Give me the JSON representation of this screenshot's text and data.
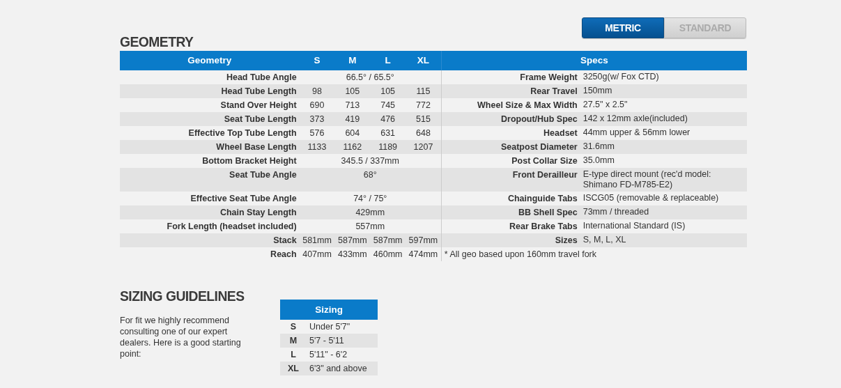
{
  "units_toggle": [
    {
      "label": "METRIC",
      "selected": true
    },
    {
      "label": "STANDARD",
      "selected": false
    }
  ],
  "geometry": {
    "title": "GEOMETRY",
    "columns": [
      "Geometry",
      "S",
      "M",
      "L",
      "XL"
    ],
    "rows": [
      {
        "label": "Head Tube Angle",
        "kind": "shared",
        "values": [
          "66.5° / 65.5°"
        ]
      },
      {
        "label": "Head Tube Length",
        "kind": "each",
        "values": [
          "98",
          "105",
          "105",
          "115"
        ]
      },
      {
        "label": "Stand Over Height",
        "kind": "each",
        "values": [
          "690",
          "713",
          "745",
          "772"
        ]
      },
      {
        "label": "Seat Tube Length",
        "kind": "each",
        "values": [
          "373",
          "419",
          "476",
          "515"
        ]
      },
      {
        "label": "Effective Top Tube Length",
        "kind": "each",
        "values": [
          "576",
          "604",
          "631",
          "648"
        ]
      },
      {
        "label": "Wheel Base Length",
        "kind": "each",
        "values": [
          "1133",
          "1162",
          "1189",
          "1207"
        ]
      },
      {
        "label": "Bottom Bracket Height",
        "kind": "shared",
        "values": [
          "345.5 / 337mm"
        ]
      },
      {
        "label": "Seat Tube Angle",
        "kind": "shared",
        "values": [
          "68°"
        ]
      },
      {
        "label": "Effective Seat Tube Angle",
        "kind": "shared",
        "values": [
          "74° / 75°"
        ]
      },
      {
        "label": "Chain Stay Length",
        "kind": "shared",
        "values": [
          "429mm"
        ]
      },
      {
        "label": "Fork Length (headset included)",
        "kind": "shared",
        "values": [
          "557mm"
        ]
      },
      {
        "label": "Stack",
        "kind": "each",
        "values": [
          "581mm",
          "587mm",
          "587mm",
          "597mm"
        ]
      },
      {
        "label": "Reach",
        "kind": "each",
        "values": [
          "407mm",
          "433mm",
          "460mm",
          "474mm"
        ]
      }
    ]
  },
  "specs": {
    "heading": "Specs",
    "rows": [
      {
        "label": "Frame Weight",
        "value": "3250g(w/ Fox CTD)"
      },
      {
        "label": "Rear Travel",
        "value": "150mm"
      },
      {
        "label": "Wheel Size & Max Width",
        "value": "27.5\" x 2.5\""
      },
      {
        "label": "Dropout/Hub Spec",
        "value": "142 x 12mm axle(included)"
      },
      {
        "label": "Headset",
        "value": "44mm upper & 56mm lower"
      },
      {
        "label": "Seatpost Diameter",
        "value": "31.6mm"
      },
      {
        "label": "Post Collar Size",
        "value": "35.0mm"
      },
      {
        "label": "Front Derailleur",
        "value": "E-type direct mount (rec'd model: Shimano FD-M785-E2)"
      },
      {
        "label": "Chainguide Tabs",
        "value": "ISCG05 (removable & replaceable)"
      },
      {
        "label": "BB Shell Spec",
        "value": "73mm / threaded"
      },
      {
        "label": "Rear Brake Tabs",
        "value": "International Standard (IS)"
      },
      {
        "label": "Sizes",
        "value": "S, M, L, XL"
      }
    ],
    "note": "* All geo based upon 160mm travel fork"
  },
  "sizing": {
    "title": "SIZING GUIDELINES",
    "text": "For fit we highly recommend consulting one of our expert dealers. Here is a good starting point:",
    "heading": "Sizing",
    "rows": [
      {
        "size": "S",
        "height": "Under 5'7\""
      },
      {
        "size": "M",
        "height": "5'7 - 5'11"
      },
      {
        "size": "L",
        "height": "5'11\" - 6'2"
      },
      {
        "size": "XL",
        "height": "6'3\" and above"
      }
    ]
  }
}
